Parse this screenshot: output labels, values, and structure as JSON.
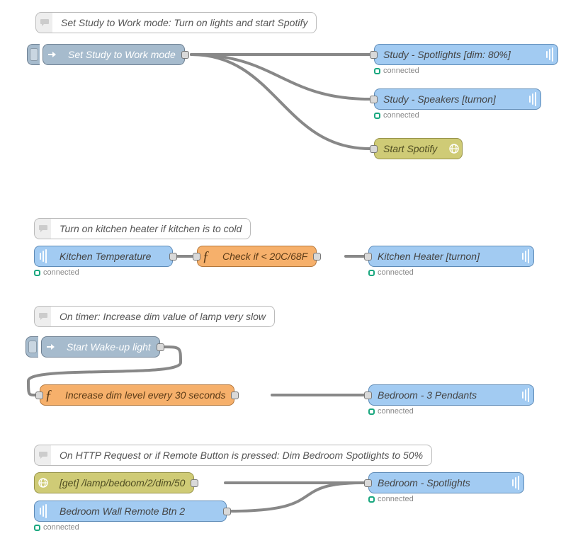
{
  "status_label": "connected",
  "flows": [
    {
      "comment": "Set Study to Work mode: Turn on lights and start Spotify",
      "inject": "Set Study to Work mode",
      "outputs": [
        {
          "label": "Study - Spotlights [dim: 80%]",
          "status": true
        },
        {
          "label": "Study - Speakers [turnon]",
          "status": true
        },
        {
          "label": "Start Spotify",
          "type": "http"
        }
      ]
    },
    {
      "comment": "Turn on kitchen heater if kitchen is to cold",
      "input": {
        "label": "Kitchen Temperature",
        "status": true
      },
      "func": "Check if < 20C/68F",
      "output": {
        "label": "Kitchen Heater [turnon]",
        "status": true
      }
    },
    {
      "comment": "On timer: Increase dim value of lamp very slow",
      "inject": "Start Wake-up light",
      "func": "Increase dim level every 30 seconds",
      "output": {
        "label": "Bedroom - 3 Pendants",
        "status": true
      }
    },
    {
      "comment": "On HTTP Request or if Remote Button is pressed: Dim Bedroom Spotlights to 50%",
      "http_in": "[get] /lamp/bedoom/2/dim/50",
      "input": {
        "label": "Bedroom Wall Remote Btn 2",
        "status": true
      },
      "output": {
        "label": "Bedroom - Spotlights",
        "status": true
      }
    }
  ]
}
